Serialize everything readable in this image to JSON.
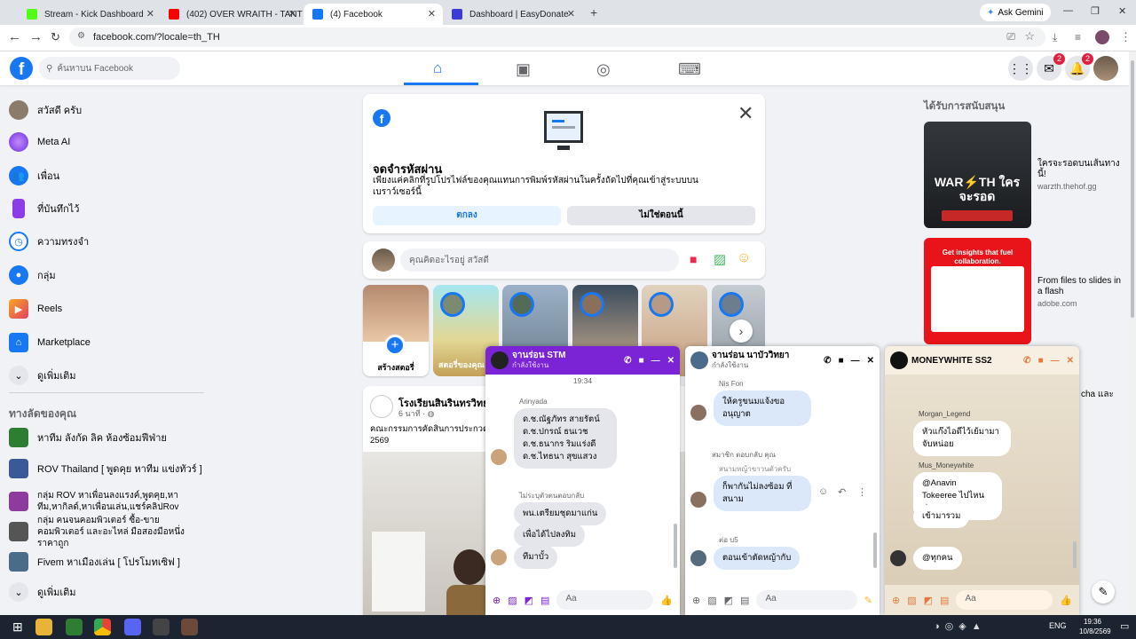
{
  "browser": {
    "tabs": [
      {
        "title": "Stream - Kick Dashboard",
        "color": "#53fc18"
      },
      {
        "title": "(402) OVER WRAITH - TANT",
        "color": "#ff0000"
      },
      {
        "title": "(4) Facebook",
        "color": "#1877f2"
      },
      {
        "title": "Dashboard | EasyDonate",
        "color": "#3b3bd9"
      }
    ],
    "ask_gemini": "Ask Gemini",
    "url": "facebook.com/?locale=th_TH"
  },
  "header": {
    "search_placeholder": "ค้นหาบน Facebook",
    "messenger_badge": "2",
    "notif_badge": "2"
  },
  "sidebar": {
    "items": [
      {
        "label": "สวัสดี ครับ",
        "icon": "avatar",
        "color": "#8a7b6b"
      },
      {
        "label": "Meta AI",
        "icon": "meta-ai-icon",
        "color": "#8b3ee8"
      },
      {
        "label": "เพื่อน",
        "icon": "friends-icon",
        "color": "#1877f2"
      },
      {
        "label": "ที่บันทึกไว้",
        "icon": "bookmark-icon",
        "color": "#8b3ee8"
      },
      {
        "label": "ความทรงจำ",
        "icon": "clock-icon",
        "color": "#1877f2"
      },
      {
        "label": "กลุ่ม",
        "icon": "groups-icon",
        "color": "#1877f2"
      },
      {
        "label": "Reels",
        "icon": "reels-icon",
        "color": "#e4405f"
      },
      {
        "label": "Marketplace",
        "icon": "shop-icon",
        "color": "#1877f2"
      },
      {
        "label": "ดูเพิ่มเติม",
        "icon": "chevron-down-icon",
        "color": "#e4e6eb"
      }
    ],
    "shortcuts_title": "ทางลัดของคุณ",
    "shortcuts": [
      {
        "label": "หาทีม ลังกัด ลิค ห้องซ้อมฟีฟ่าย",
        "color": "#2d7d32"
      },
      {
        "label": "ROV Thailand [ พูดคุย หาทีม แข่งทัวร์ ]",
        "color": "#3b5998"
      },
      {
        "label": "กลุ่ม ROV หาเพื่อนลงแรงค์,พูดคุย,หาทีม,หากิลด์,หาเพื่อนเล่น,แชร์คลิปRov",
        "color": "#8e3b9e"
      },
      {
        "label": "กลุ่ม คนจนคอมพิวเตอร์ ซื้อ-ขาย คอมพิวเตอร์ และอะไหล่ มือสองมือหนึ่ง ราคาถูก",
        "color": "#555"
      },
      {
        "label": "Fivem หาเมืองเล่น [ โปรโมทเซิฟ ]",
        "color": "#4a6b8a"
      }
    ],
    "see_more_2": "ดูเพิ่มเติม"
  },
  "password_card": {
    "title": "จดจำรหัสผ่าน",
    "desc": "เพียงแค่คลิกที่รูปโปรไฟล์ของคุณแทนการพิมพ์รหัสผ่านในครั้งถัดไปที่คุณเข้าสู่ระบบบนเบราว์เซอร์นี้",
    "ok": "ตกลง",
    "not_now": "ไม่ใช่ตอนนี้"
  },
  "composer": {
    "placeholder": "คุณคิดอะไรอยู่ สวัสดี"
  },
  "stories": {
    "create_label": "สร้างสตอรี่",
    "story2_label": "สตอรี่ของคุณ"
  },
  "post": {
    "page": "โรงเรียนสินรินทรวิทยา",
    "time": "6 นาที · ",
    "text": "คณะกรรมการคัดสินการประกวดภ 2569"
  },
  "sponsored": {
    "title": "ได้รับการสนับสนุน",
    "ad1_text": "ใครจะรอดบนเส้นทางนี้!",
    "ad1_domain": "warzth.thehof.gg",
    "ad1_art": "WAR⚡TH ใครจะรอด",
    "ad2_text": "From files to slides in a flash",
    "ad2_domain": "adobe.com",
    "ad2_art": "Get insights that fuel collaboration."
  },
  "right_edge_text": "cha และ",
  "chats": [
    {
      "name": "จานร่อน STM",
      "status": "กำลังใช้งาน",
      "time": "19:34",
      "sender": "Arinyada",
      "msg1": "ด.ช.ณัฐภัทร สายรัตน์\nด.ช.ปกรณ์ ธนเวช\nด.ช.ธนากร ริมแร่งดี\nด.ช.ไทธนา สุขแสวง",
      "reply_label": "ไม่ระบุตัวตนตอบกลับ",
      "msg2": "พน.เตรียมชุดมาแก่น",
      "msg3": "เพื่อได้ไปลงทิม",
      "msg4": "ทีมาบั้ว",
      "input": "Aa"
    },
    {
      "name": "จานร่อน นาบัววิทยา",
      "status": "กำลังใช้งาน",
      "sender": "Nis Fon",
      "msg1": "ให้ครูขนมแจ้งขออนุญาต",
      "reply_label": "สมาชิก ตอบกลับ คุณ",
      "quoted": "สนามหญ้าขาวนตัวครับ",
      "msg2": "ก็พากันไม่ลงซ้อม ที่สนาม",
      "sender2": "ต่อ บ5",
      "msg3": "ตอนเข้าตัดหญ้ากับ",
      "input": "Aa"
    },
    {
      "name": "MONEYWHITE SS2",
      "sender1": "Morgan_Legend",
      "msg1": "หัวแก๊งไอดีไว้เย้มามาจับหน่อย",
      "sender2": "Mus_Moneywhite",
      "msg2": "@Anavin Tokeeree ไปไหนต่อง",
      "msg3": "เข้ามารวม",
      "msg4": "@ทุกคน",
      "input": "Aa"
    }
  ],
  "taskbar": {
    "lang": "ENG",
    "time": "19:36",
    "date": "10/8/2569"
  }
}
